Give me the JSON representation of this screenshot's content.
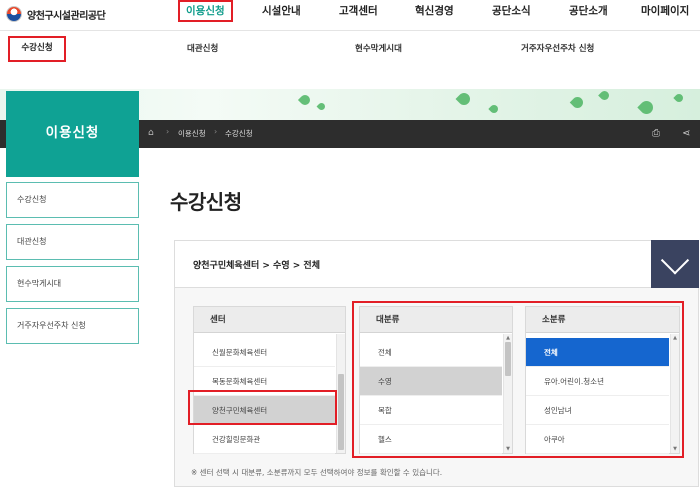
{
  "header": {
    "logo_text": "양천구시설관리공단",
    "nav": [
      "이용신청",
      "시설안내",
      "고객센터",
      "혁신경영",
      "공단소식",
      "공단소개",
      "마이페이지"
    ]
  },
  "subnav": [
    "수강신청",
    "대관신청",
    "현수막게시대",
    "거주자우선주차 신청"
  ],
  "breadcrumb": {
    "home_icon": "home-icon",
    "items": [
      "이용신청",
      "수강신청"
    ],
    "right_icons": [
      "print-icon",
      "share-icon"
    ]
  },
  "sidebar": {
    "title": "이용신청",
    "items": [
      "수강신청",
      "대관신청",
      "현수막게시대",
      "거주자우선주차 신청"
    ]
  },
  "page_title": "수강신청",
  "selection_path": "양천구민체육센터 > 수영 > 전체",
  "columns": {
    "center": {
      "header": "센터",
      "items": [
        "신월문화체육센터",
        "목동문화체육센터",
        "양천구민체육센터",
        "건강힐링문화관"
      ],
      "selected": "양천구민체육센터"
    },
    "major": {
      "header": "대분류",
      "items": [
        "전체",
        "수영",
        "복합",
        "헬스"
      ],
      "selected": "수영"
    },
    "minor": {
      "header": "소분류",
      "items": [
        "전체",
        "유아.어린이.청소년",
        "성인남녀",
        "아쿠아"
      ],
      "selected": "전체"
    }
  },
  "note": "※ 센터 선택 시 대분류, 소분류까지 모두 선택하여야 정보를 확인할 수 있습니다.",
  "colors": {
    "accent": "#0fa294",
    "highlight": "#e21e26",
    "selected_blue": "#1566cf",
    "toggle_bg": "#3a4360"
  }
}
